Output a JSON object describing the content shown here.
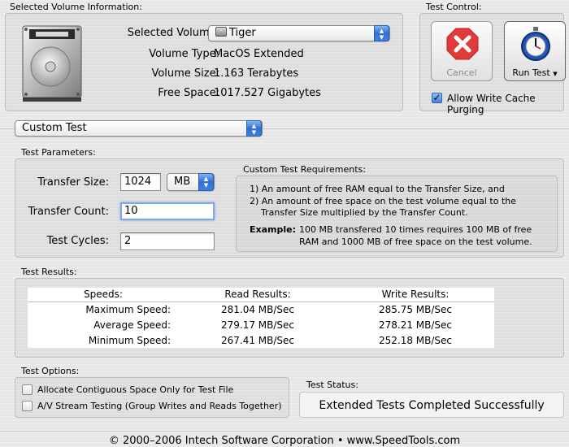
{
  "volume_info": {
    "group_title": "Selected Volume Information:",
    "selected_volume_label": "Selected Volume:",
    "selected_volume_value": "Tiger",
    "volume_type_label": "Volume Type:",
    "volume_type_value": "MacOS Extended",
    "volume_size_label": "Volume Size:",
    "volume_size_value": "1.163 Terabytes",
    "free_space_label": "Free Space:",
    "free_space_value": "1017.527 Gigabytes"
  },
  "test_control": {
    "group_title": "Test Control:",
    "cancel_label": "Cancel",
    "run_test_label": "Run Test",
    "allow_write_cache_label": "Allow Write Cache Purging",
    "allow_write_cache_checked": true
  },
  "test_type": {
    "selected": "Custom Test"
  },
  "test_parameters": {
    "group_title": "Test Parameters:",
    "transfer_size_label": "Transfer Size:",
    "transfer_size_value": "1024",
    "transfer_unit": "MB",
    "transfer_count_label": "Transfer Count:",
    "transfer_count_value": "10",
    "test_cycles_label": "Test Cycles:",
    "test_cycles_value": "2"
  },
  "requirements": {
    "title": "Custom Test Requirements:",
    "item1": "1) An amount of free RAM equal to the Transfer Size, and",
    "item2_line1": "2) An amount of free space on the test volume equal to the",
    "item2_line2": "Transfer Size multiplied by the Transfer Count.",
    "example_label": "Example:",
    "example_line1": "100 MB transfered 10 times requires 100 MB of free",
    "example_line2": "RAM and 1000 MB of free space on the test volume."
  },
  "results": {
    "group_title": "Test Results:",
    "columns": [
      "Speeds:",
      "Read Results:",
      "Write Results:"
    ],
    "rows": [
      {
        "label": "Maximum Speed:",
        "read": "281.04 MB/Sec",
        "write": "285.75 MB/Sec"
      },
      {
        "label": "Average Speed:",
        "read": "279.17 MB/Sec",
        "write": "278.21 MB/Sec"
      },
      {
        "label": "Minimum Speed:",
        "read": "267.41 MB/Sec",
        "write": "252.18 MB/Sec"
      }
    ]
  },
  "options": {
    "group_title": "Test Options:",
    "contiguous_label": "Allocate Contiguous Space Only for Test File",
    "contiguous_checked": false,
    "av_stream_label": "A/V Stream Testing (Group Writes and Reads Together)",
    "av_stream_checked": false
  },
  "status": {
    "group_title": "Test Status:",
    "text": "Extended Tests Completed Successfully"
  },
  "footer": "© 2000–2006 Intech Software Corporation  •  www.SpeedTools.com",
  "colors": {
    "cancel_red": "#e03a3a",
    "focus_blue": "#7ea6e0",
    "popup_blue": "#2f6fd4"
  }
}
